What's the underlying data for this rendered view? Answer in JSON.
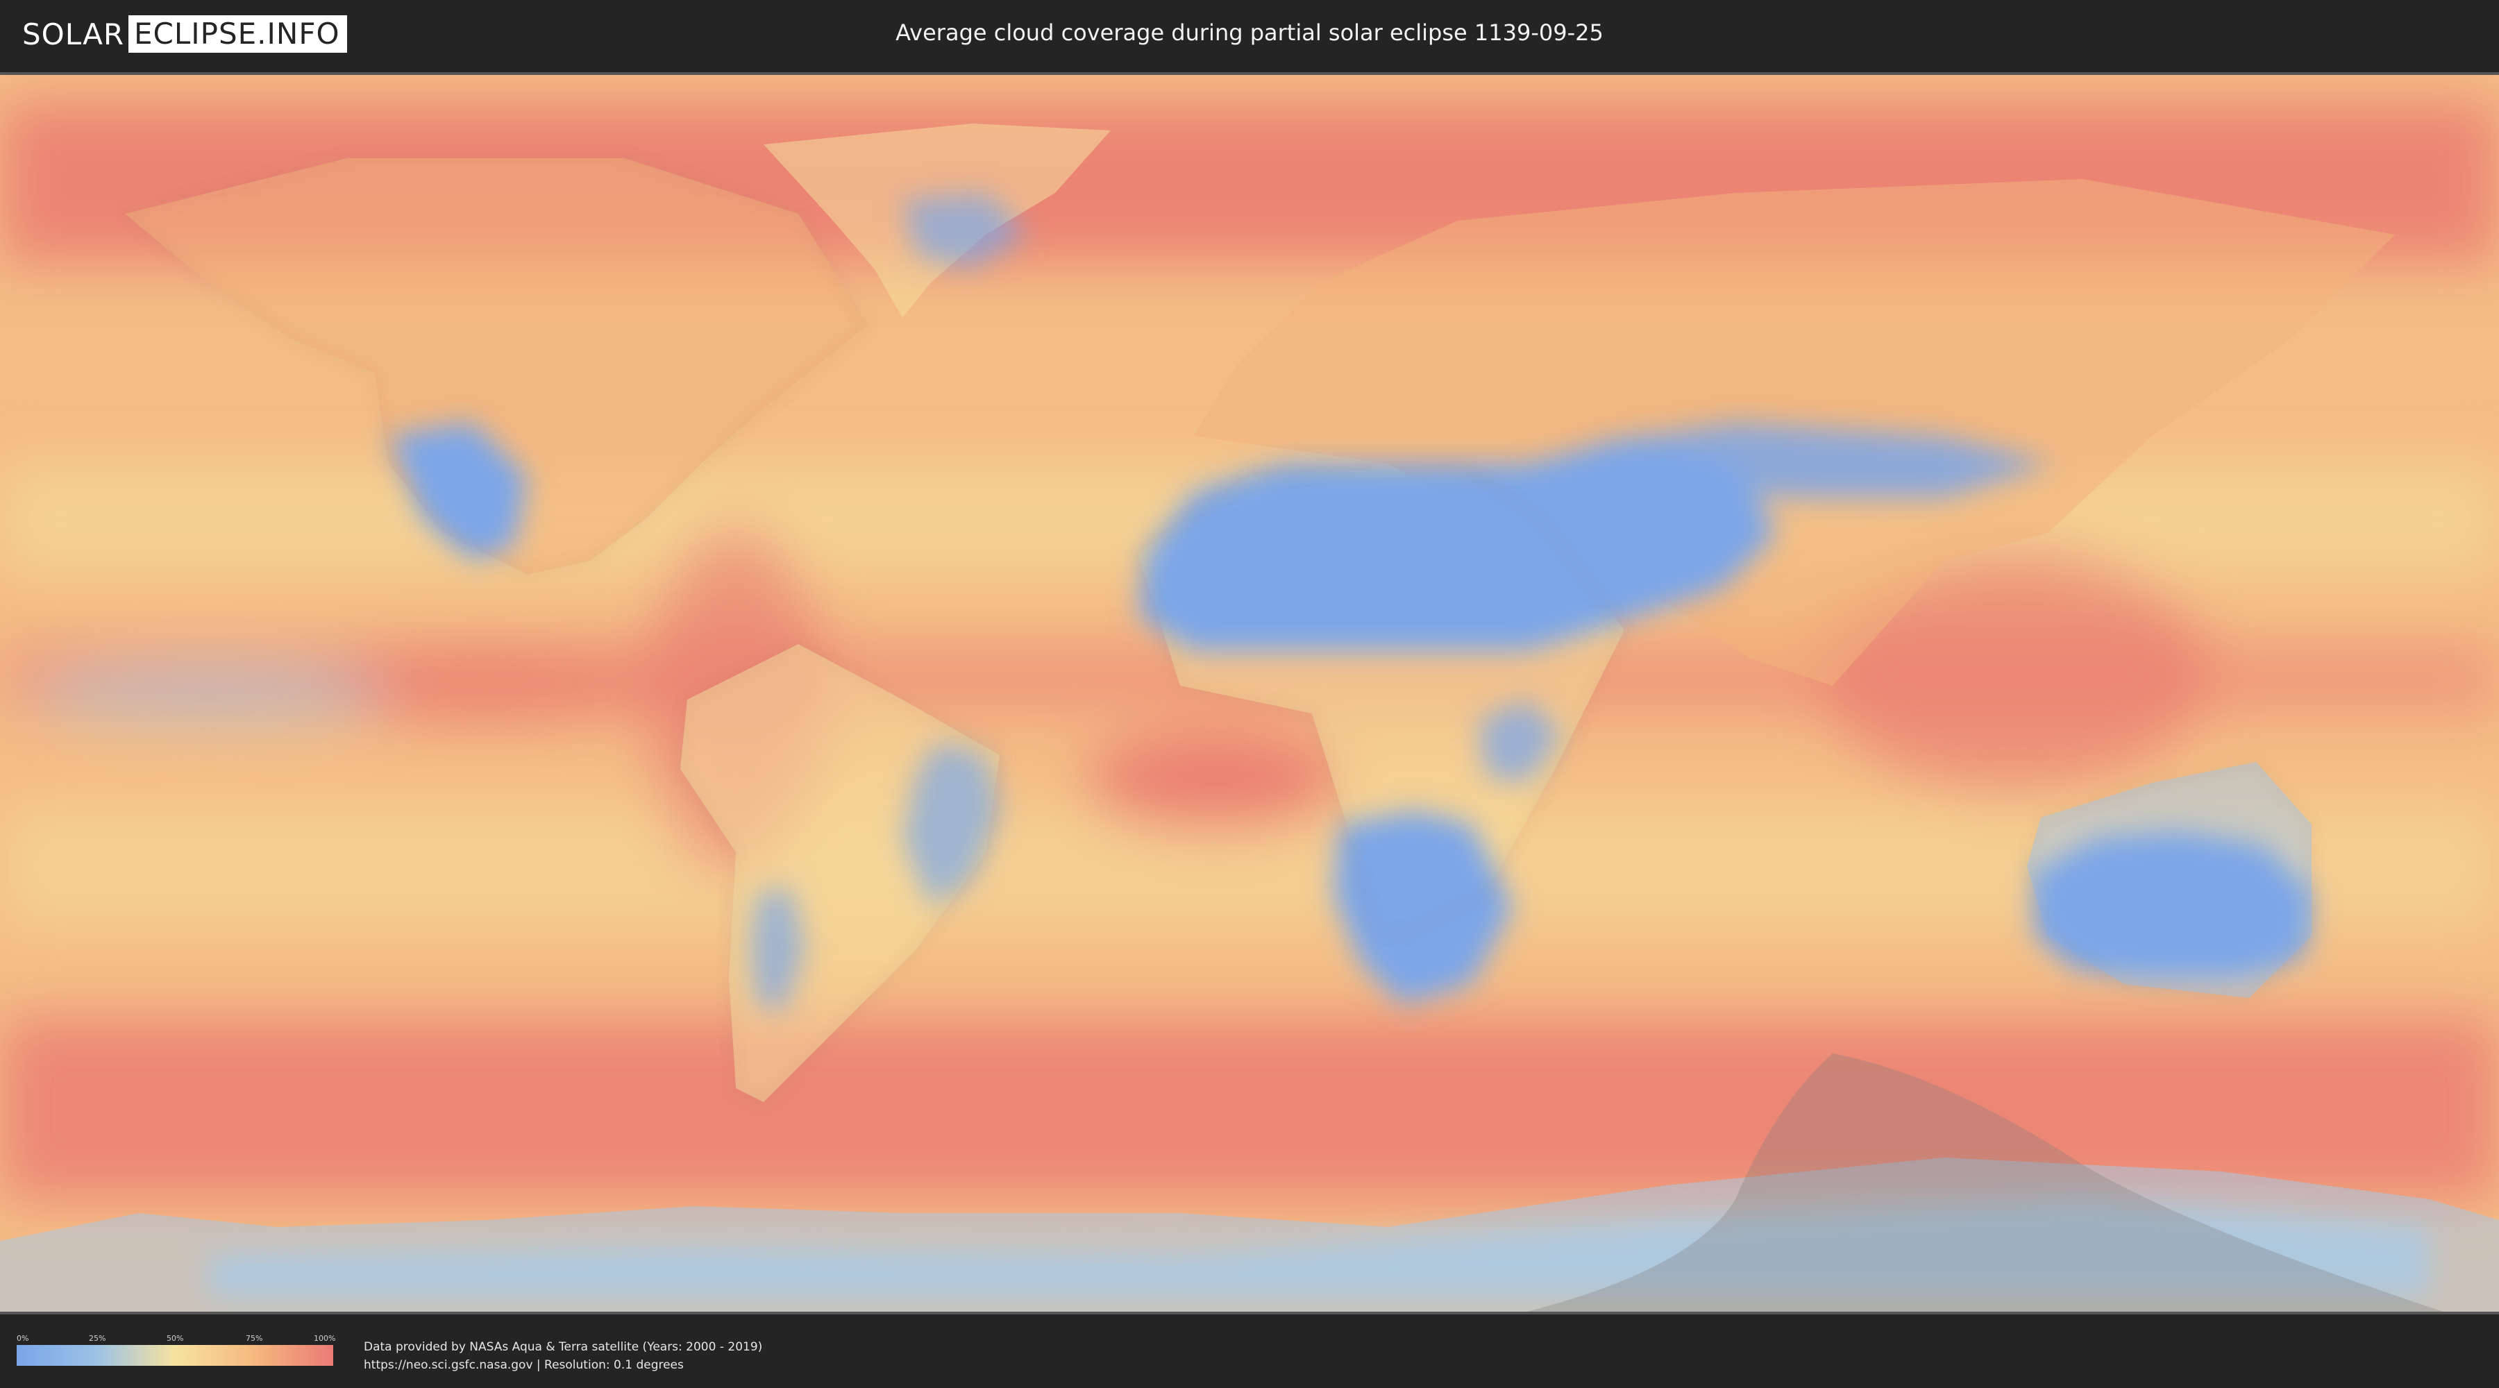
{
  "header": {
    "logo_left": "SOLAR",
    "logo_right": "ECLIPSE.INFO",
    "title": "Average cloud coverage during partial solar eclipse 1139-09-25"
  },
  "map": {
    "colors": {
      "clear": "#7ba6e8",
      "low": "#a9c9e4",
      "mid": "#f5dd9c",
      "high": "#f3b27c",
      "overcast": "#e8716d",
      "eclipse_shadow": "#7a7a7a"
    }
  },
  "legend": {
    "ticks": [
      "0%",
      "25%",
      "50%",
      "75%",
      "100%"
    ],
    "colors": [
      "#7aa5e8",
      "#9cc2e6",
      "#f6e2a0",
      "#f5b97e",
      "#ea7b76"
    ]
  },
  "footer": {
    "credit_line1": "Data provided by NASAs Aqua & Terra satellite (Years: 2000 - 2019)",
    "credit_line2": "https://neo.sci.gsfc.nasa.gov | Resolution: 0.1 degrees"
  }
}
